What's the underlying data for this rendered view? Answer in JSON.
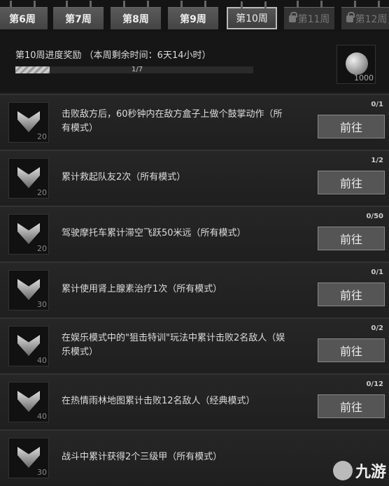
{
  "tabs": [
    {
      "label": "第6周"
    },
    {
      "label": "第7周"
    },
    {
      "label": "第8周"
    },
    {
      "label": "第9周"
    },
    {
      "label": "第10周",
      "active": true
    },
    {
      "label": "第11周",
      "locked": true
    },
    {
      "label": "第12周",
      "locked": true
    }
  ],
  "progress": {
    "title": "第10周进度奖励 （本周剩余时间：6天14小时）",
    "text": "1/7",
    "current": 1,
    "total": 7,
    "reward_icon": "silver-coin-icon",
    "reward_count": "1000"
  },
  "tasks": [
    {
      "desc": "击败敌方后，60秒钟内在敌方盒子上做个鼓掌动作（所有模式）",
      "count": "0/1",
      "level": "20",
      "button": "前往"
    },
    {
      "desc": "累计救起队友2次（所有模式）",
      "count": "1/2",
      "level": "20",
      "button": "前往"
    },
    {
      "desc": "驾驶摩托车累计滞空飞跃50米远（所有模式）",
      "count": "0/50",
      "level": "20",
      "button": "前往"
    },
    {
      "desc": "累计使用肾上腺素治疗1次（所有模式）",
      "count": "0/1",
      "level": "30",
      "button": "前往"
    },
    {
      "desc": "在娱乐模式中的\"狙击特训\"玩法中累计击败2名敌人（娱乐模式）",
      "count": "0/2",
      "level": "40",
      "button": "前往"
    },
    {
      "desc": "在热情雨林地图累计击败12名敌人（经典模式）",
      "count": "0/12",
      "level": "40",
      "button": "前往"
    },
    {
      "desc": "战斗中累计获得2个三级甲（所有模式）",
      "count": "",
      "level": "30",
      "button": ""
    }
  ],
  "watermark": "九游"
}
